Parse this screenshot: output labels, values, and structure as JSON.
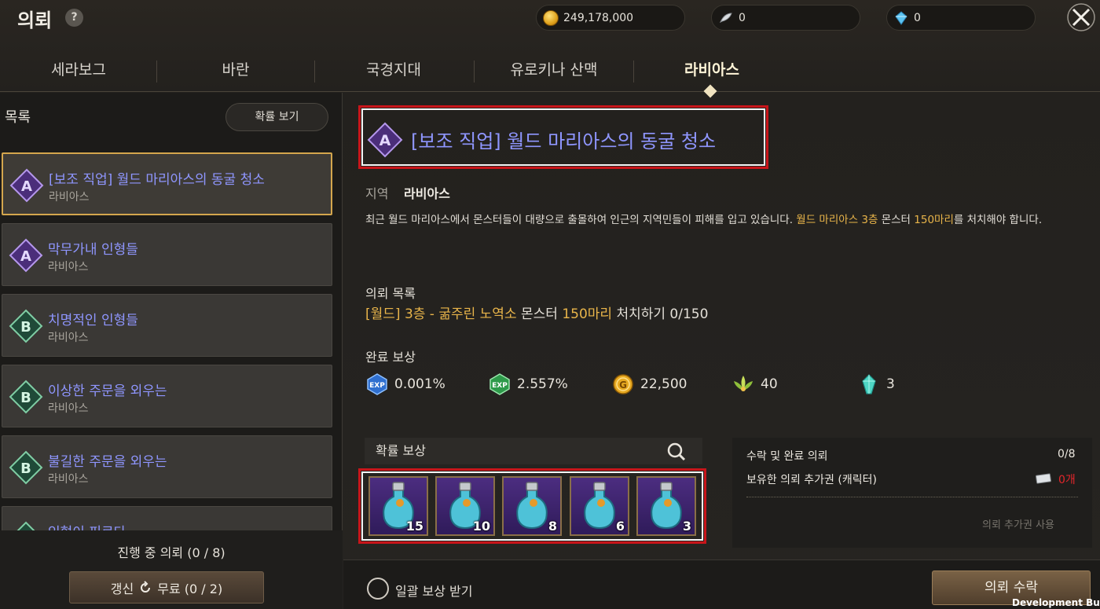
{
  "header": {
    "title": "의뢰",
    "help": "?",
    "gold": "249,178,000",
    "silver": "0",
    "crystal": "0"
  },
  "tabs": [
    {
      "label": "세라보그"
    },
    {
      "label": "바란"
    },
    {
      "label": "국경지대"
    },
    {
      "label": "유로키나 산맥"
    },
    {
      "label": "라비아스",
      "active": true
    }
  ],
  "list": {
    "header": "목록",
    "prob_button": "확률 보기",
    "items": [
      {
        "grade": "A",
        "name": "[보조 직업] 월드 마리아스의 동굴 청소",
        "region": "라비아스",
        "selected": true
      },
      {
        "grade": "A",
        "name": "막무가내 인형들",
        "region": "라비아스"
      },
      {
        "grade": "B",
        "name": "치명적인 인형들",
        "region": "라비아스"
      },
      {
        "grade": "B",
        "name": "이상한 주문을 외우는",
        "region": "라비아스"
      },
      {
        "grade": "B",
        "name": "불길한 주문을 외우는",
        "region": "라비아스"
      },
      {
        "grade": "B",
        "name": "인형이 피르다",
        "region": ""
      }
    ],
    "in_progress": "진행 중 의뢰 (0 / 8)",
    "refresh_label": "갱신",
    "refresh_free": "무료 (0 / 2)"
  },
  "detail": {
    "grade": "A",
    "title": "[보조 직업] 월드 마리아스의 동굴 청소",
    "region_label": "지역",
    "region_value": "라비아스",
    "desc_1": "최근 월드 마리아스에서 몬스터들이 대량으로 출몰하여 인근의 지역민들이 피해를 입고 있습니다. ",
    "desc_hl1": "월드 마리아스 3층",
    "desc_2": " 몬스터 ",
    "desc_hl2": "150마리",
    "desc_3": "를 처치해야 합니다.",
    "objective_header": "의뢰 목록",
    "objective_hl1": "[월드] 3층 - 굶주린 노역소",
    "objective_mid": " 몬스터 ",
    "objective_hl2": "150마리",
    "objective_end": " 처치하기 0/150",
    "reward_header": "완료 보상",
    "rewards": [
      {
        "icon": "exp-blue-icon",
        "value": "0.001%"
      },
      {
        "icon": "exp-green-icon",
        "value": "2.557%"
      },
      {
        "icon": "gold-coin-icon",
        "value": "22,500"
      },
      {
        "icon": "leaf-icon",
        "value": "40"
      },
      {
        "icon": "crystal-icon",
        "value": "3"
      }
    ],
    "prob_reward_header": "확률 보상",
    "prob_items": [
      {
        "count": "15"
      },
      {
        "count": "10"
      },
      {
        "count": "8"
      },
      {
        "count": "6"
      },
      {
        "count": "3"
      }
    ]
  },
  "info": {
    "accepted_label": "수락 및 완료 의뢰",
    "accepted_value": "0/8",
    "ticket_label": "보유한 의뢰 추가권 (캐릭터)",
    "ticket_value": "0개",
    "use_ticket": "의뢰 추가권 사용"
  },
  "footer": {
    "bulk_reward": "일괄 보상 받기",
    "accept": "의뢰 수락",
    "dev_build": "Development Buil"
  },
  "colors": {
    "quest_name": "#8f96ff",
    "highlight": "#e9b54a",
    "selection_border": "#d4a64d",
    "red_highlight": "#c8151a"
  }
}
